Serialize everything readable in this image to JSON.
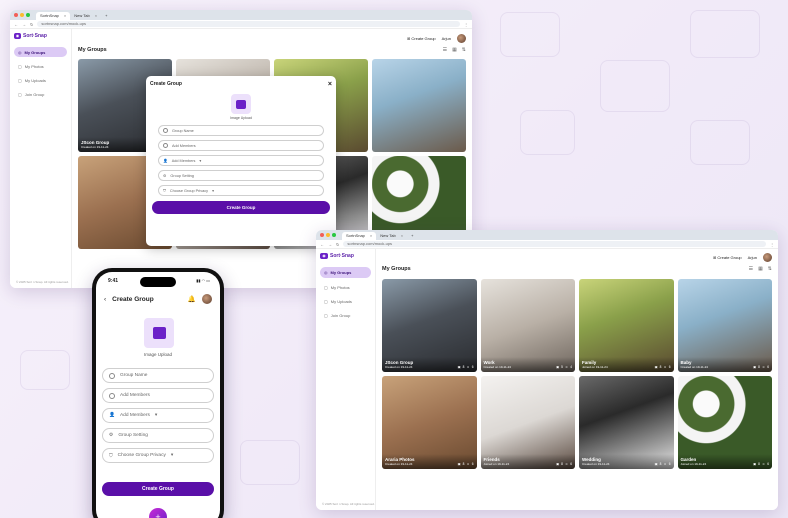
{
  "browser": {
    "tab_active": "SortnSnap",
    "tab_new": "New Tab",
    "url": "sortnsnap.com/mock-ups"
  },
  "app": {
    "logo_text": "Sort·Snap",
    "nav": [
      "My Groups",
      "My Photos",
      "My Uploads",
      "Join Group"
    ],
    "copyright": "© 2025 Sort n Snap. All rights reserved.",
    "create_group_btn": "Create Group",
    "user_name": "Arjun",
    "page_title": "My Groups"
  },
  "groups": [
    {
      "name": "JScon Group",
      "date": "Created on 19-11-24",
      "photos": "8",
      "members": "6"
    },
    {
      "name": "Work",
      "date": "Created on 19-11-24",
      "photos": "5",
      "members": "4"
    },
    {
      "name": "Family",
      "date": "Joined on 19-11-24",
      "photos": "8",
      "members": "6"
    },
    {
      "name": "Baby",
      "date": "Created on 19-11-24",
      "photos": "8",
      "members": "6"
    },
    {
      "name": "Araria Photos",
      "date": "Created on 19-11-24",
      "photos": "8",
      "members": "6"
    },
    {
      "name": "Friends",
      "date": "Joined on 19-11-24",
      "photos": "8",
      "members": "6"
    },
    {
      "name": "Wedding",
      "date": "Created on 19-11-24",
      "photos": "8",
      "members": "6"
    },
    {
      "name": "Garden",
      "date": "Joined on 19-11-24",
      "photos": "8",
      "members": "6"
    }
  ],
  "modal": {
    "title": "Create Group",
    "upload_label": "Image Upload",
    "group_name_placeholder": "Group Name",
    "add_members_placeholder": "Add Members",
    "add_members_dropdown": "Add Members",
    "group_setting": "Group Setting",
    "privacy_placeholder": "Choose Group Privacy",
    "submit": "Create Group"
  },
  "phone": {
    "time": "9:41",
    "title": "Create Group"
  },
  "colors": {
    "brand": "#6b21c8",
    "brand_dark": "#5a0fa8",
    "nav_active_bg": "#dccaf5"
  }
}
